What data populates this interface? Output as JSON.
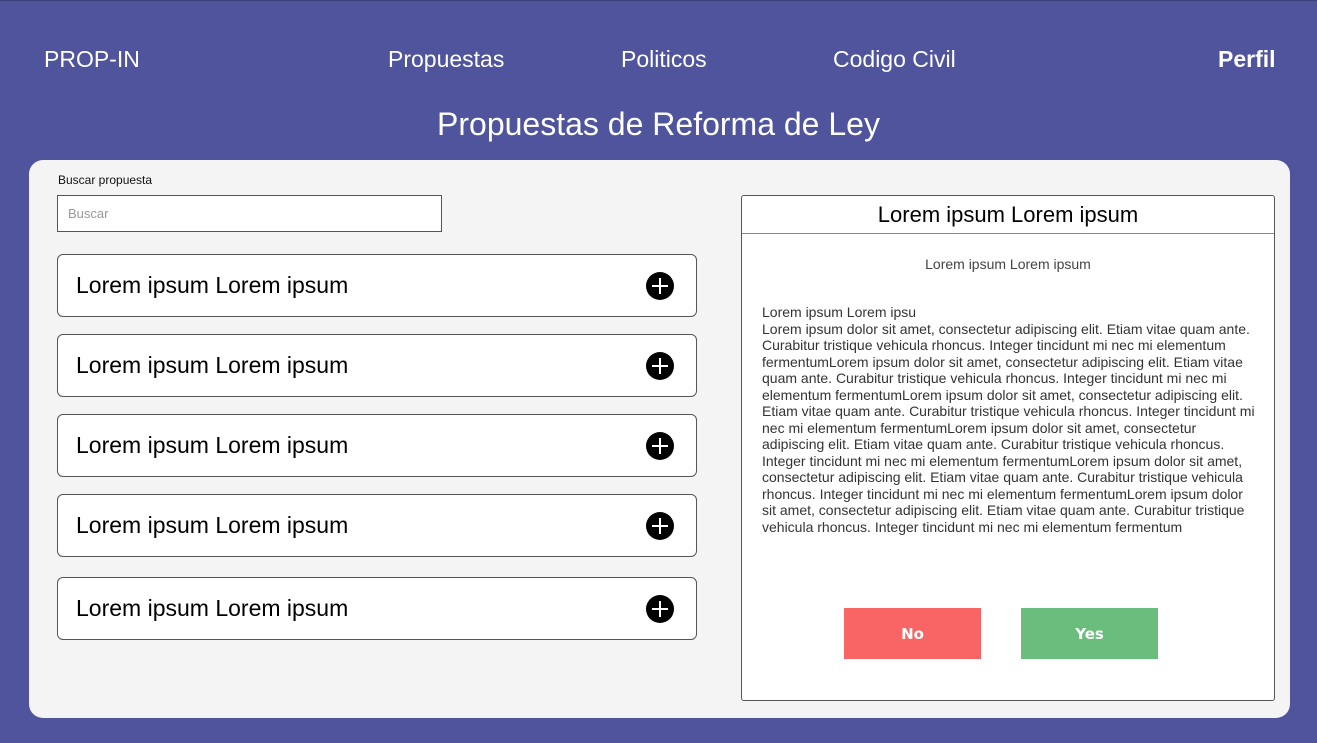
{
  "header": {
    "brand": "PROP-IN",
    "nav": [
      "Propuestas",
      "Politicos",
      "Codigo Civil"
    ],
    "profile": "Perfil"
  },
  "page_title": "Propuestas de Reforma de Ley",
  "search": {
    "label": "Buscar propuesta",
    "placeholder": "Buscar",
    "value": ""
  },
  "proposals": [
    {
      "title": "Lorem ipsum Lorem ipsum",
      "icon": "plus-circle-icon"
    },
    {
      "title": "Lorem ipsum Lorem ipsum",
      "icon": "plus-circle-icon"
    },
    {
      "title": "Lorem ipsum Lorem ipsum",
      "icon": "plus-circle-icon"
    },
    {
      "title": "Lorem ipsum Lorem ipsum",
      "icon": "plus-circle-icon"
    },
    {
      "title": "Lorem ipsum Lorem ipsum",
      "icon": "plus-circle-icon"
    }
  ],
  "detail": {
    "title": "Lorem ipsum Lorem ipsum",
    "subtitle": "Lorem ipsum Lorem ipsum",
    "body_heading": "Lorem ipsum Lorem ipsu",
    "body": "Lorem ipsum dolor sit amet, consectetur adipiscing elit. Etiam vitae quam ante. Curabitur tristique vehicula rhoncus. Integer tincidunt mi nec mi elementum fermentumLorem ipsum dolor sit amet, consectetur adipiscing elit. Etiam vitae quam ante. Curabitur tristique vehicula rhoncus. Integer tincidunt mi nec mi elementum fermentumLorem ipsum dolor sit amet, consectetur adipiscing elit. Etiam vitae quam ante. Curabitur tristique vehicula rhoncus. Integer tincidunt mi nec mi elementum fermentumLorem ipsum dolor sit amet, consectetur adipiscing elit. Etiam vitae quam ante. Curabitur tristique vehicula rhoncus. Integer tincidunt mi nec mi elementum fermentumLorem ipsum dolor sit amet, consectetur adipiscing elit. Etiam vitae quam ante. Curabitur tristique vehicula rhoncus. Integer tincidunt mi nec mi elementum fermentumLorem ipsum dolor sit amet, consectetur adipiscing elit. Etiam vitae quam ante. Curabitur tristique vehicula rhoncus. Integer tincidunt mi nec mi elementum fermentum",
    "no_label": "No",
    "yes_label": "Yes"
  },
  "colors": {
    "background": "#4f549c",
    "panel": "#f4f4f4",
    "no_button": "#f96564",
    "yes_button": "#6bbd7d"
  }
}
